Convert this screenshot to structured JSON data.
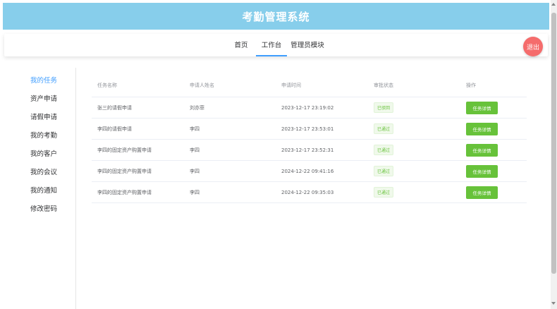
{
  "app": {
    "title": "考勤管理系统"
  },
  "nav": {
    "tabs": [
      {
        "label": "首页"
      },
      {
        "label": "工作台"
      },
      {
        "label": "管理员模块"
      }
    ],
    "active_tab": "工作台",
    "logout_label": "退出"
  },
  "sidebar": {
    "items": [
      {
        "label": "我的任务"
      },
      {
        "label": "资产申请"
      },
      {
        "label": "请假申请"
      },
      {
        "label": "我的考勤"
      },
      {
        "label": "我的客户"
      },
      {
        "label": "我的会议"
      },
      {
        "label": "我的通知"
      },
      {
        "label": "修改密码"
      }
    ],
    "active_item": "我的任务"
  },
  "table": {
    "headers": [
      "任务名称",
      "申请人姓名",
      "申请时间",
      "审批状态",
      "操作"
    ],
    "rows": [
      {
        "task": "张三的请假申请",
        "applicant": "刘亦菲",
        "time": "2023-12-17 23:19:02",
        "status": "已驳回",
        "action": "任务详情"
      },
      {
        "task": "李四的请假申请",
        "applicant": "李四",
        "time": "2023-12-17 23:53:01",
        "status": "已通过",
        "action": "任务详情"
      },
      {
        "task": "李四的固定资产购置申请",
        "applicant": "李四",
        "time": "2023-12-17 23:52:31",
        "status": "已通过",
        "action": "任务详情"
      },
      {
        "task": "李四的固定资产购置申请",
        "applicant": "李四",
        "time": "2024-12-22 09:41:16",
        "status": "已通过",
        "action": "任务详情"
      },
      {
        "task": "李四的固定资产购置申请",
        "applicant": "李四",
        "time": "2024-12-22 09:35:03",
        "status": "已通过",
        "action": "任务详情"
      }
    ]
  },
  "colors": {
    "header_bg": "#87ceeb",
    "accent": "#409eff",
    "success": "#67c23a",
    "logout": "#f56c6c"
  }
}
